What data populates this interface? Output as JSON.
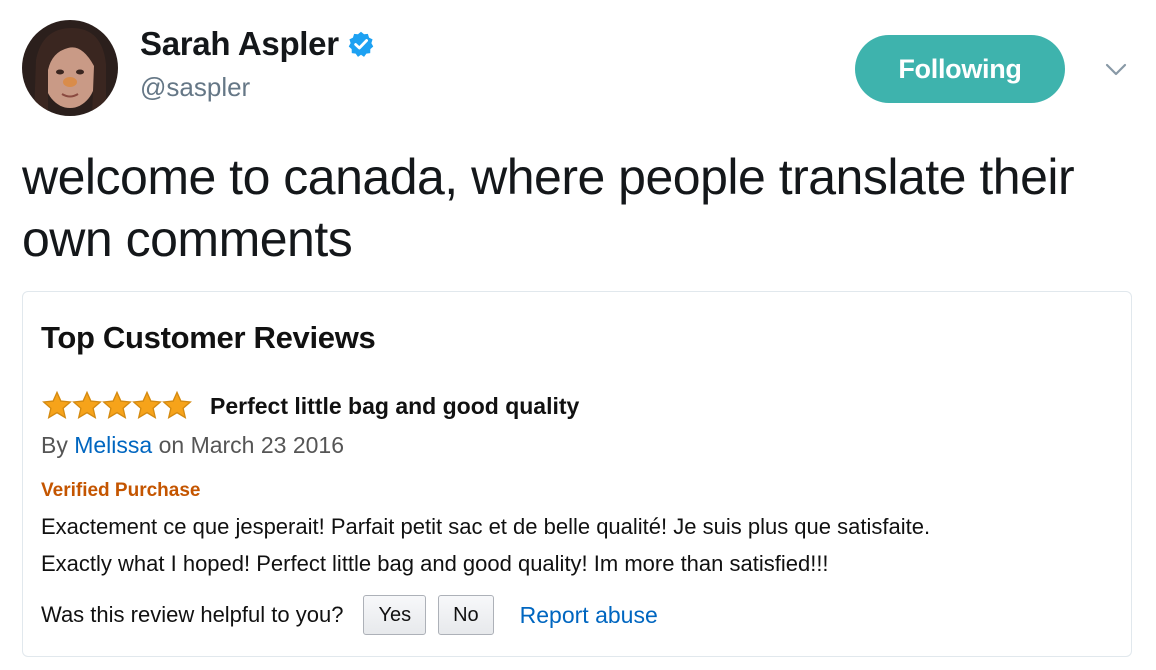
{
  "tweet": {
    "author": {
      "display_name": "Sarah Aspler",
      "handle": "@saspler",
      "verified_badge_color": "#1da1f2"
    },
    "follow_button_label": "Following",
    "follow_button_color": "#3eb3ad",
    "text": "welcome to canada, where people translate their own comments"
  },
  "review_card": {
    "heading": "Top Customer Reviews",
    "rating_stars": 5,
    "star_color": "#f6a31a",
    "review_title": "Perfect little bag and good quality",
    "byline_prefix": "By",
    "author": "Melissa",
    "date_text": "on March 23 2016",
    "verified_label": "Verified Purchase",
    "body_french": "Exactement ce que jesperait! Parfait petit sac et de belle qualité! Je suis plus que satisfaite.",
    "body_english": "Exactly what I hoped! Perfect little bag and good quality! Im more than satisfied!!!",
    "helpful_question": "Was this review helpful to you?",
    "yes_label": "Yes",
    "no_label": "No",
    "report_label": "Report abuse",
    "link_color": "#0066c0"
  }
}
